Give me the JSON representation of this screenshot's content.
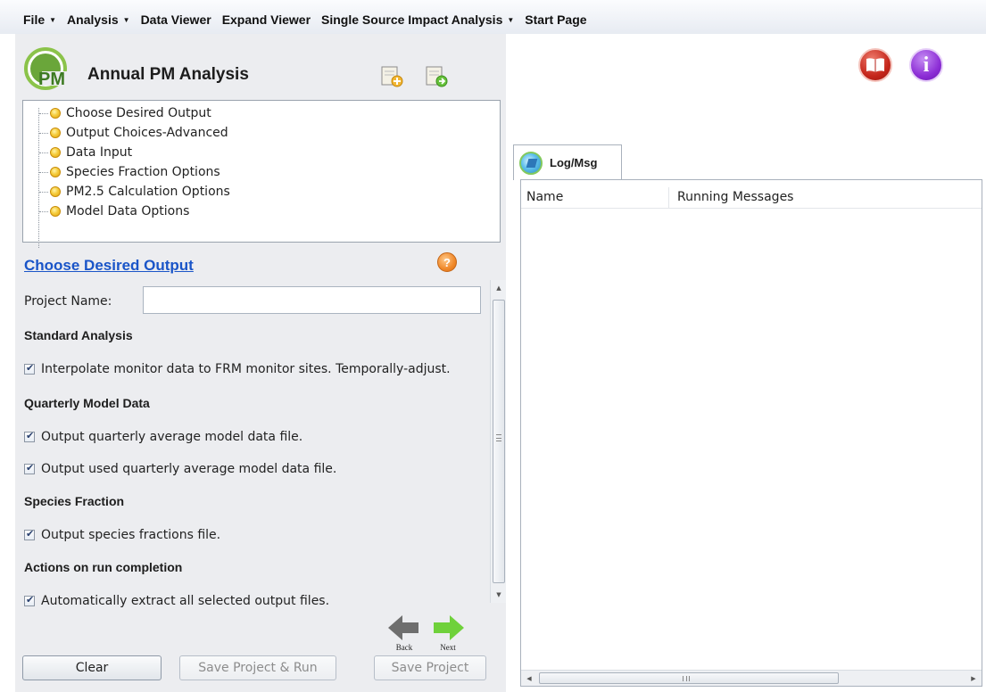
{
  "menu": [
    {
      "label": "File",
      "dropdown": true
    },
    {
      "label": "Analysis",
      "dropdown": true
    },
    {
      "label": "Data Viewer",
      "dropdown": false
    },
    {
      "label": "Expand Viewer",
      "dropdown": false
    },
    {
      "label": "Single Source Impact Analysis",
      "dropdown": true
    },
    {
      "label": "Start Page",
      "dropdown": false
    }
  ],
  "app": {
    "logo_text": "PM",
    "title": "Annual PM Analysis"
  },
  "tree": [
    {
      "label": "Choose Desired Output"
    },
    {
      "label": "Output Choices-Advanced"
    },
    {
      "label": "Data Input"
    },
    {
      "label": "Species Fraction Options"
    },
    {
      "label": "PM2.5 Calculation Options"
    },
    {
      "label": "Model Data Options"
    }
  ],
  "section": {
    "title": "Choose Desired Output",
    "help_icon": "?"
  },
  "form": {
    "project_name_label": "Project Name:",
    "project_name_value": "",
    "standard_analysis": {
      "heading": "Standard Analysis",
      "items": [
        {
          "label": "Interpolate monitor data to FRM monitor sites. Temporally-adjust.",
          "checked": true
        }
      ]
    },
    "quarterly_model_data": {
      "heading": "Quarterly Model Data",
      "items": [
        {
          "label": "Output quarterly average model data file.",
          "checked": true
        },
        {
          "label": "Output used quarterly average model data file.",
          "checked": true
        }
      ]
    },
    "species_fraction": {
      "heading": "Species Fraction",
      "items": [
        {
          "label": "Output species fractions file.",
          "checked": true
        }
      ]
    },
    "actions": {
      "heading": "Actions on run completion",
      "items": [
        {
          "label": "Automatically extract all selected output files.",
          "checked": true
        }
      ]
    }
  },
  "navigation": {
    "back_label": "Back",
    "next_label": "Next"
  },
  "buttons": {
    "clear": "Clear",
    "save_run": "Save Project & Run",
    "save_project": "Save Project"
  },
  "log": {
    "tab_label": "Log/Msg",
    "columns": [
      "Name",
      "Running Messages"
    ],
    "rows": []
  },
  "icons": {
    "new_project": "new-document-icon",
    "open_project": "open-document-icon",
    "help_manual": "book-icon",
    "about": "info-icon",
    "info_glyph": "i"
  },
  "colors": {
    "link_blue": "#1a55c8",
    "panel_bg": "#ecedf0",
    "back_arrow": "#6e6e6e",
    "next_arrow": "#6fd13b"
  }
}
